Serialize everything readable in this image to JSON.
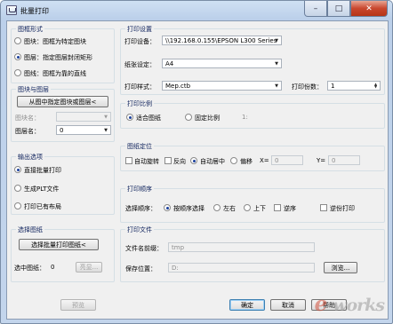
{
  "window": {
    "title": "批量打印",
    "close_glyph": "✕",
    "max_glyph": "□",
    "min_glyph": "–"
  },
  "frame": {
    "title": "图框形式",
    "options": [
      "图块：图框为特定图块",
      "图层：指定图层封闭矩形",
      "图线：图框为靠的直线"
    ],
    "selected": 1
  },
  "block_layer": {
    "title": "图块与图层",
    "pick_button": "从图中指定图块或图层<",
    "block_name_label": "图块名：",
    "block_name_value": "",
    "layer_name_label": "图层名：",
    "layer_name_value": "0"
  },
  "output": {
    "title": "输出选项",
    "options": [
      "直接批量打印",
      "生成PLT文件",
      "打印已有布局"
    ],
    "selected": 0
  },
  "select": {
    "title": "选择图纸",
    "select_button": "选择批量打印图纸<",
    "count_label": "选中图纸：",
    "count": "0",
    "highlight_button": "亮显..."
  },
  "print_settings": {
    "title": "打印设置",
    "device_label": "打印设备：",
    "device_value": "\\\\192.168.0.155\\EPSON L300 Series",
    "paper_label": "纸张设定：",
    "paper_value": "A4",
    "style_label": "打印样式：",
    "style_value": "Mep.ctb",
    "copies_label": "打印份数：",
    "copies_value": "1"
  },
  "scale": {
    "title": "打印比例",
    "fit_label": "适合图纸",
    "fixed_label": "固定比例",
    "ratio_label": "1:",
    "ratio_value": "",
    "selected": "fit"
  },
  "position": {
    "title": "图纸定位",
    "auto_rotate": "自动旋转",
    "reverse": "反向",
    "auto_center": "自动居中",
    "offset": "偏移",
    "x_label": "X=",
    "x_value": "0",
    "y_label": "Y=",
    "y_value": "0"
  },
  "order": {
    "title": "打印顺序",
    "select_label": "选择顺序：",
    "by_order": "按顺序选择",
    "left_right": "左右",
    "up_down": "上下",
    "reverse": "逆序",
    "reverse_print": "逆份打印"
  },
  "print_file": {
    "title": "打印文件",
    "prefix_label": "文件名前缀：",
    "prefix_value": "tmp",
    "save_label": "保存位置：",
    "save_value": "D:",
    "browse_button": "浏览..."
  },
  "footer": {
    "preview": "预览",
    "ok": "确定",
    "cancel": "取消",
    "help": "帮助"
  },
  "watermark": {
    "text": "e-works"
  },
  "colors": {
    "accent": "#1a3f9c",
    "group_title": "#0b1f5a",
    "close": "#c9472e"
  }
}
